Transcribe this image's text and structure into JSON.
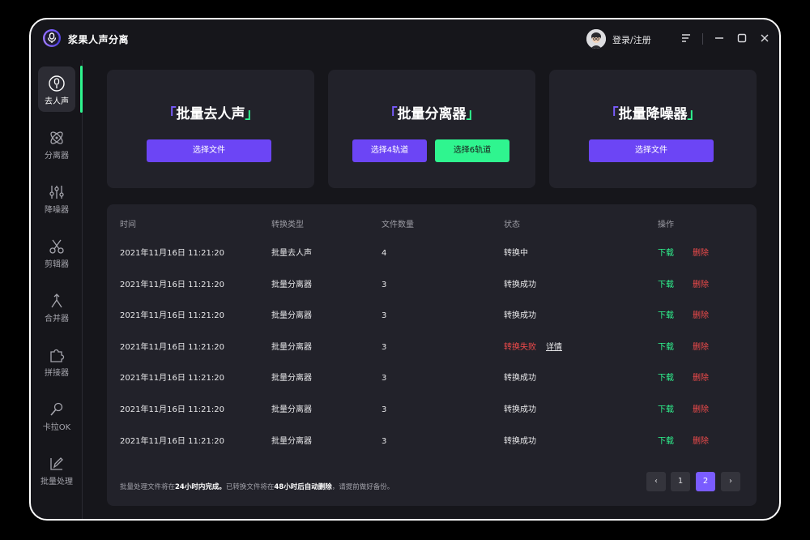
{
  "app": {
    "title": "浆果人声分离"
  },
  "header": {
    "login_label": "登录/注册"
  },
  "sidebar": {
    "items": [
      {
        "label": "去人声"
      },
      {
        "label": "分离器"
      },
      {
        "label": "降噪器"
      },
      {
        "label": "剪辑器"
      },
      {
        "label": "合并器"
      },
      {
        "label": "拼接器"
      },
      {
        "label": "卡拉OK"
      },
      {
        "label": "批量处理"
      }
    ],
    "active_index": 0
  },
  "cards": [
    {
      "bracket_left": "「",
      "title": "批量去人声",
      "bracket_right": "」",
      "buttons": [
        "选择文件"
      ]
    },
    {
      "bracket_left": "「",
      "title": "批量分离器",
      "bracket_right": "」",
      "buttons": [
        "选择4轨道",
        "选择6轨道"
      ]
    },
    {
      "bracket_left": "「",
      "title": "批量降噪器",
      "bracket_right": "」",
      "buttons": [
        "选择文件"
      ]
    }
  ],
  "table": {
    "headers": [
      "时间",
      "转换类型",
      "文件数量",
      "状态",
      "操作"
    ],
    "rows": [
      {
        "time": "2021年11月16日 11:21:20",
        "type": "批量去人声",
        "count": "4",
        "status": "转换中"
      },
      {
        "time": "2021年11月16日 11:21:20",
        "type": "批量分离器",
        "count": "3",
        "status": "转换成功"
      },
      {
        "time": "2021年11月16日 11:21:20",
        "type": "批量分离器",
        "count": "3",
        "status": "转换成功"
      },
      {
        "time": "2021年11月16日 11:21:20",
        "type": "批量分离器",
        "count": "3",
        "status": "转换失败",
        "detail": "详情"
      },
      {
        "time": "2021年11月16日 11:21:20",
        "type": "批量分离器",
        "count": "3",
        "status": "转换成功"
      },
      {
        "time": "2021年11月16日 11:21:20",
        "type": "批量分离器",
        "count": "3",
        "status": "转换成功"
      },
      {
        "time": "2021年11月16日 11:21:20",
        "type": "批量分离器",
        "count": "3",
        "status": "转换成功"
      }
    ],
    "actions": {
      "download": "下载",
      "delete": "删除"
    }
  },
  "footer": {
    "note_1": "批量处理文件将在",
    "note_2": "24小时内完成。",
    "note_3": "已转换文件将在",
    "note_4": "48小时后自动删除",
    "note_5": "，请提前做好备份。"
  },
  "pagination": {
    "pages": [
      "1",
      "2"
    ],
    "current": "2",
    "prev": "‹",
    "next": "›"
  },
  "colors": {
    "accent": "#6c45f5",
    "success": "#2ff58f",
    "danger": "#f04b4b",
    "panel": "#22222a",
    "background": "#16161b"
  }
}
